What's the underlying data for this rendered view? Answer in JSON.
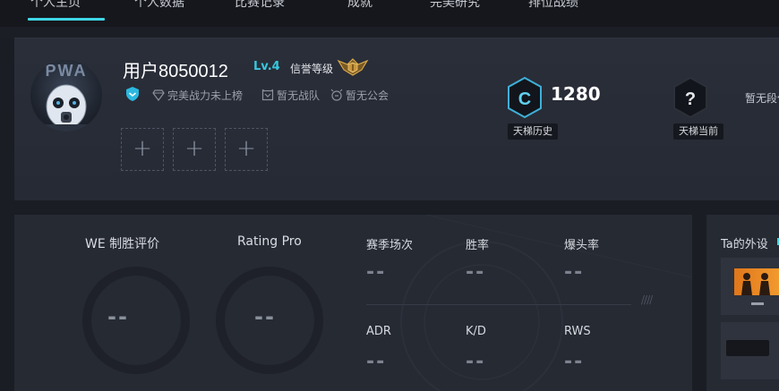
{
  "nav": {
    "tabs": [
      "个人主页",
      "个人数据",
      "比赛记录",
      "成就",
      "完美研究",
      "排位战绩"
    ]
  },
  "profile": {
    "avatar_text": "PWA",
    "username": "用户8050012",
    "level": "Lv.4",
    "credit_label": "信誉等级",
    "meta": {
      "power_text": "完美战力未上榜",
      "team_text": "暂无战队",
      "guild_text": "暂无公会"
    },
    "ladder_history": {
      "score": "1280",
      "label": "天梯历史"
    },
    "ladder_current": {
      "icon_text": "?",
      "label": "天梯当前",
      "status": "暂无段位"
    }
  },
  "stats": {
    "we_title": "WE 制胜评价",
    "we_value": "--",
    "rating_title": "Rating Pro",
    "rating_value": "--",
    "items": [
      {
        "label": "赛季场次",
        "value": "--"
      },
      {
        "label": "胜率",
        "value": "--"
      },
      {
        "label": "爆头率",
        "value": "--"
      },
      {
        "label": "ADR",
        "value": "--"
      },
      {
        "label": "K/D",
        "value": "--"
      },
      {
        "label": "RWS",
        "value": "--"
      }
    ],
    "slashes": "////"
  },
  "equipment": {
    "title": "Ta的外设"
  },
  "colors": {
    "accent": "#3fd6e6",
    "level": "#36c8e0",
    "panel": "#262a33",
    "background": "#1a1d24"
  }
}
